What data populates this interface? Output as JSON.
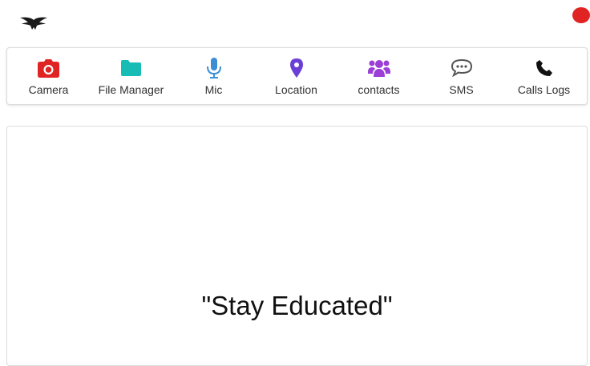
{
  "colors": {
    "status_dot": "#e02424",
    "camera": "#e02424",
    "file_manager": "#17bdb5",
    "mic": "#3b8fd4",
    "location": "#6a3fd6",
    "contacts": "#9b3fd6",
    "sms": "#555555",
    "calls_logs": "#111111"
  },
  "header": {
    "logo_icon": "eagle-logo-icon",
    "status_icon": "status-dot-icon"
  },
  "toolbar": {
    "items": [
      {
        "label": "Camera",
        "icon": "camera-icon"
      },
      {
        "label": "File Manager",
        "icon": "folder-icon"
      },
      {
        "label": "Mic",
        "icon": "microphone-icon"
      },
      {
        "label": "Location",
        "icon": "map-pin-icon"
      },
      {
        "label": "contacts",
        "icon": "users-icon"
      },
      {
        "label": "SMS",
        "icon": "chat-bubble-icon"
      },
      {
        "label": "Calls Logs",
        "icon": "phone-icon"
      }
    ]
  },
  "main": {
    "quote": "\"Stay Educated\""
  }
}
